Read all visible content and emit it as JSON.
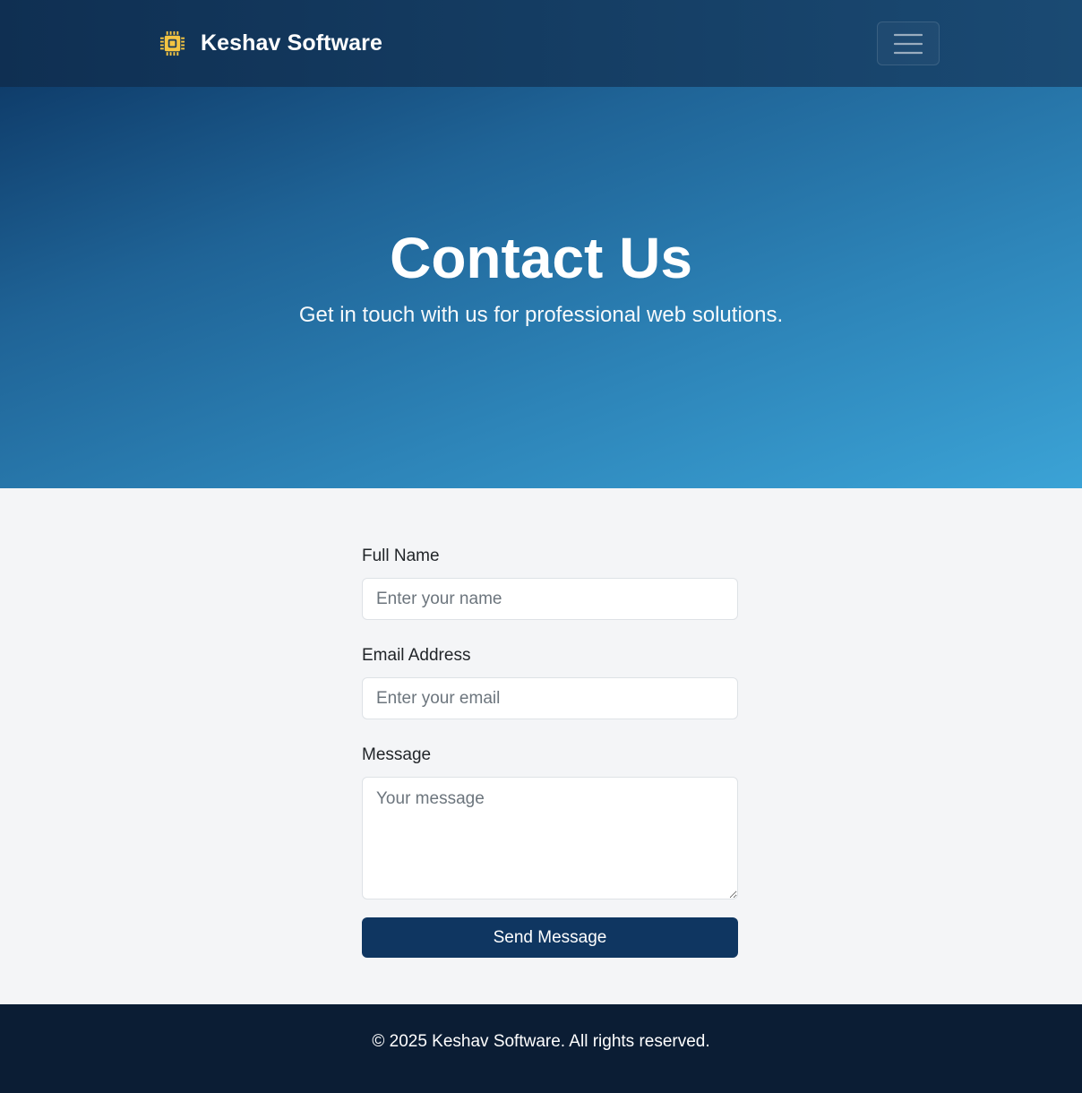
{
  "navbar": {
    "brand_name": "Keshav Software",
    "brand_icon": "microchip-icon",
    "menu_icon": "hamburger-menu-icon"
  },
  "hero": {
    "title": "Contact Us",
    "subtitle": "Get in touch with us for professional web solutions."
  },
  "form": {
    "name_label": "Full Name",
    "name_placeholder": "Enter your name",
    "name_value": "",
    "email_label": "Email Address",
    "email_placeholder": "Enter your email",
    "email_value": "",
    "message_label": "Message",
    "message_placeholder": "Your message",
    "message_value": "",
    "submit_label": "Send Message"
  },
  "footer": {
    "text": "© 2025 Keshav Software. All rights reserved."
  },
  "colors": {
    "navbar_start": "#0f2f52",
    "navbar_end": "#1a4a73",
    "hero_start": "#0f3d6b",
    "hero_end": "#3ba3d6",
    "brand_icon": "#f4c542",
    "button": "#0f3661",
    "footer": "#0b1d34",
    "page_bg": "#f4f5f7"
  }
}
